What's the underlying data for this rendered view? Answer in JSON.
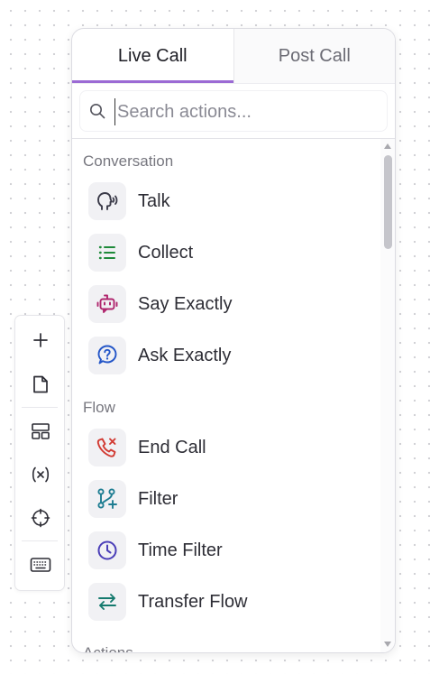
{
  "toolbar": {
    "buttons": [
      {
        "icon": "plus-icon"
      },
      {
        "icon": "document-icon"
      },
      {
        "icon": "layout-icon"
      },
      {
        "icon": "variable-icon"
      },
      {
        "icon": "crosshair-icon"
      },
      {
        "icon": "keyboard-icon"
      }
    ]
  },
  "panel": {
    "tabs": [
      {
        "label": "Live Call",
        "active": true
      },
      {
        "label": "Post Call",
        "active": false
      }
    ],
    "search": {
      "placeholder": "Search actions...",
      "value": ""
    },
    "sections": [
      {
        "title": "Conversation",
        "items": [
          {
            "label": "Talk",
            "icon": "speaking-head-icon",
            "color": "#3a3a48"
          },
          {
            "label": "Collect",
            "icon": "list-icon",
            "color": "#1f8a3a"
          },
          {
            "label": "Say Exactly",
            "icon": "robot-icon",
            "color": "#b0266e"
          },
          {
            "label": "Ask Exactly",
            "icon": "question-bubble-icon",
            "color": "#2456c8"
          }
        ]
      },
      {
        "title": "Flow",
        "items": [
          {
            "label": "End Call",
            "icon": "phone-x-icon",
            "color": "#d23a32"
          },
          {
            "label": "Filter",
            "icon": "branch-plus-icon",
            "color": "#1e7d92"
          },
          {
            "label": "Time Filter",
            "icon": "clock-icon",
            "color": "#4b3fb8"
          },
          {
            "label": "Transfer Flow",
            "icon": "transfer-arrows-icon",
            "color": "#157a6e"
          }
        ]
      },
      {
        "title": "Actions",
        "items": []
      }
    ]
  },
  "colors": {
    "tab_underline": "#9b6ad4"
  }
}
